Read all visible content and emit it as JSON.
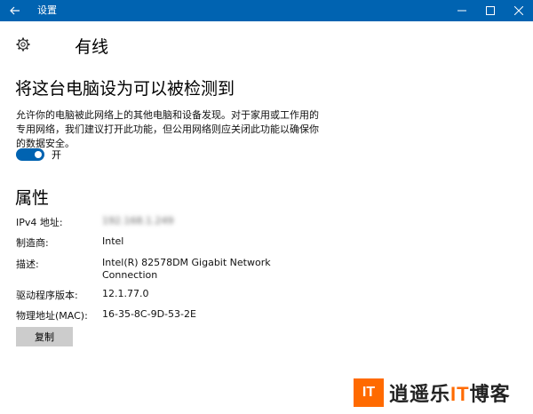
{
  "window": {
    "title": "设置"
  },
  "page": {
    "title": "有线"
  },
  "discover": {
    "heading": "将这台电脑设为可以被检测到",
    "description": "允许你的电脑被此网络上的其他电脑和设备发现。对于家用或工作用的专用网络，我们建议打开此功能，但公用网络则应关闭此功能以确保你的数据安全。",
    "toggle_state": "开",
    "toggle_on": true
  },
  "properties": {
    "heading": "属性",
    "ipv4_label": "IPv4 地址:",
    "ipv4_value": "192.168.1.249",
    "manufacturer_label": "制造商:",
    "manufacturer_value": "Intel",
    "description_label": "描述:",
    "description_value_line1": "Intel(R) 82578DM Gigabit Network",
    "description_value_line2": "Connection",
    "driver_label": "驱动程序版本:",
    "driver_value": "12.1.77.0",
    "mac_label": "物理地址(MAC):",
    "mac_value": "16-35-8C-9D-53-2E",
    "copy_label": "复制"
  },
  "watermark": {
    "badge": "IT",
    "text_a": "逍遥乐",
    "text_it": "IT",
    "text_b": "博客"
  },
  "colors": {
    "accent": "#0063b1",
    "button_bg": "#cccccc",
    "watermark_orange": "#ff6a00"
  }
}
